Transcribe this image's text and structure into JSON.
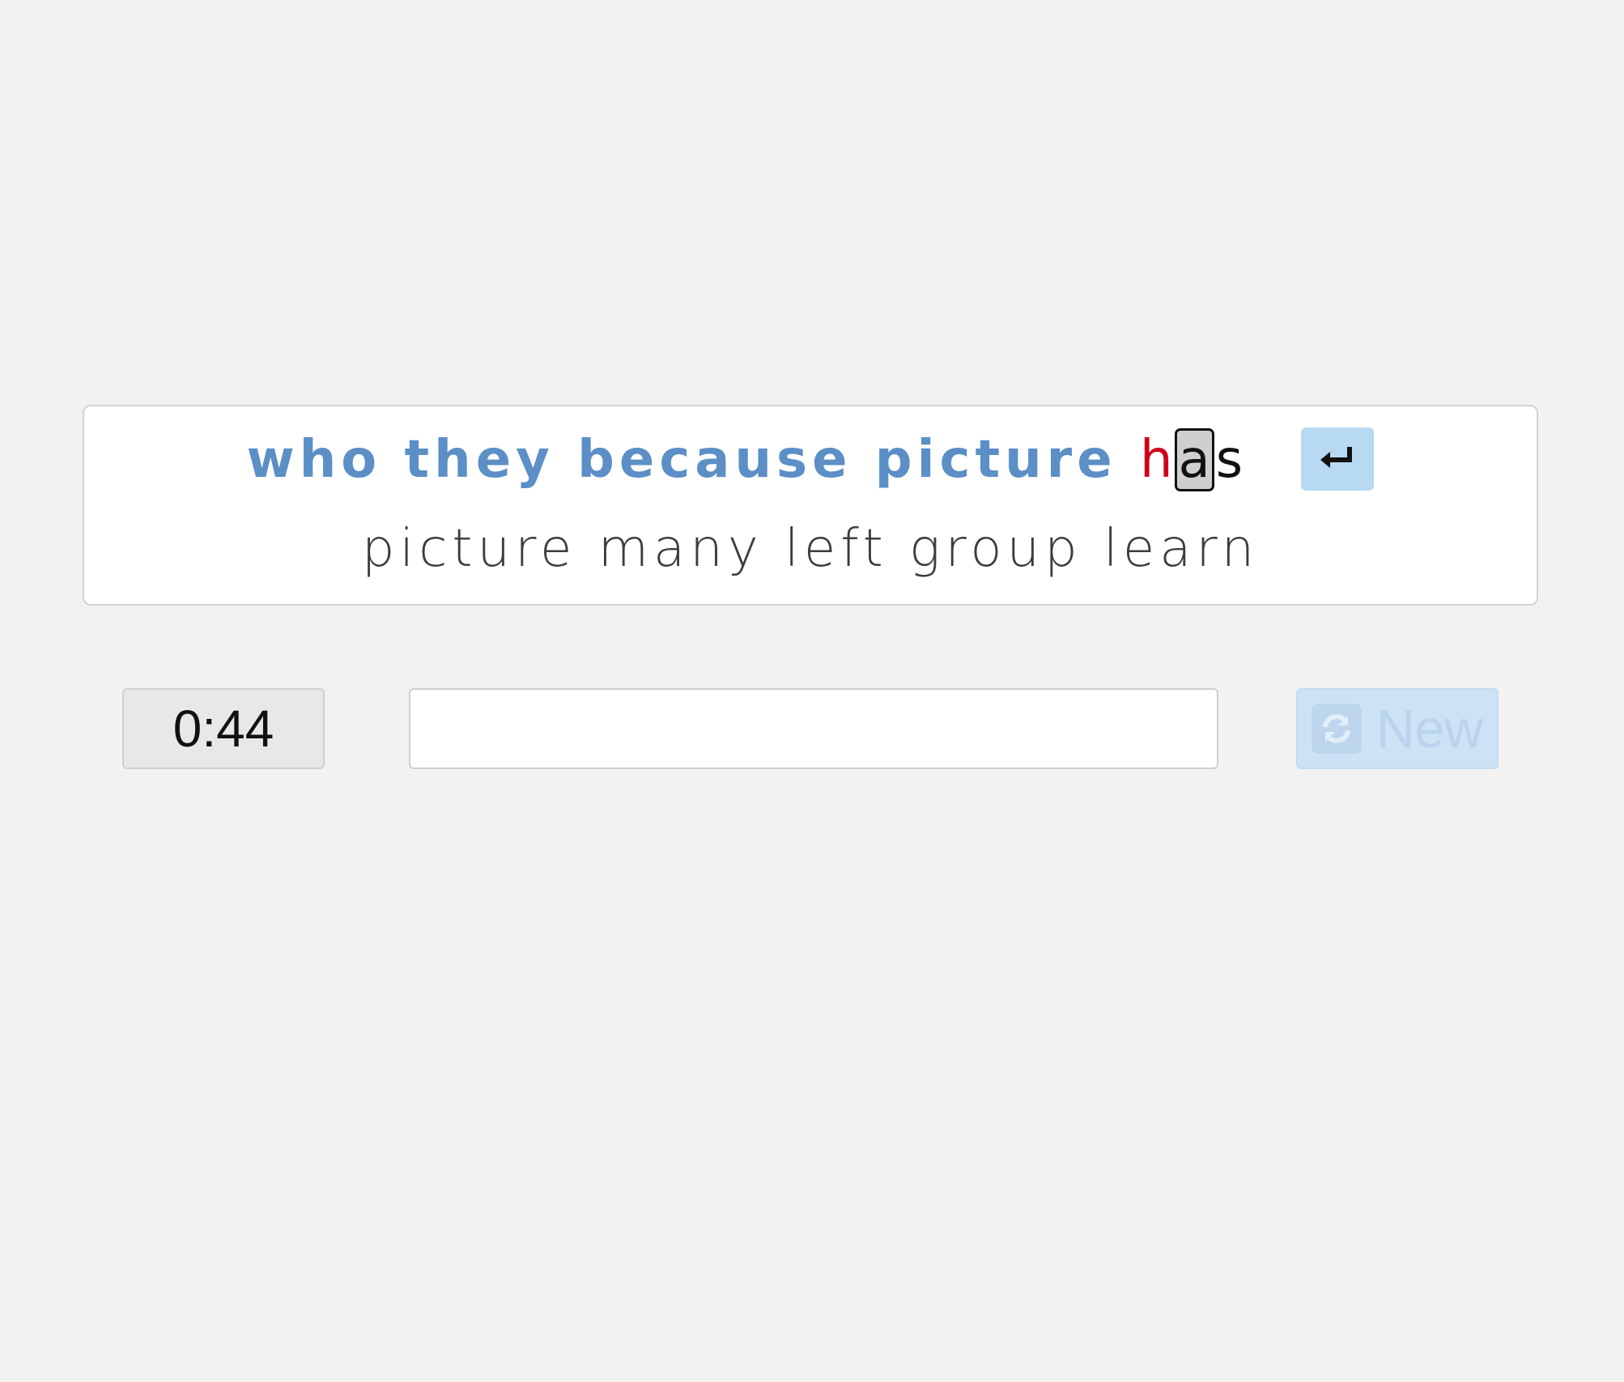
{
  "prompt": {
    "typed_words": "who they because picture",
    "current_word": {
      "chars": [
        "h",
        "a",
        "s"
      ],
      "wrong_index": 0,
      "cursor_index": 1
    },
    "enter_key_icon": "enter-icon",
    "next_line": "picture many left group learn"
  },
  "timer": {
    "value": "0:44"
  },
  "input": {
    "value": ""
  },
  "new_button": {
    "label": "New",
    "icon": "refresh-icon",
    "state": "disabled"
  },
  "colors": {
    "typed_words": "#5b8fc6",
    "error_char": "#d0021b",
    "enter_key_bg": "#b7d9f2",
    "new_button_bg": "#cde2f5",
    "page_bg": "#f2f2f2"
  }
}
